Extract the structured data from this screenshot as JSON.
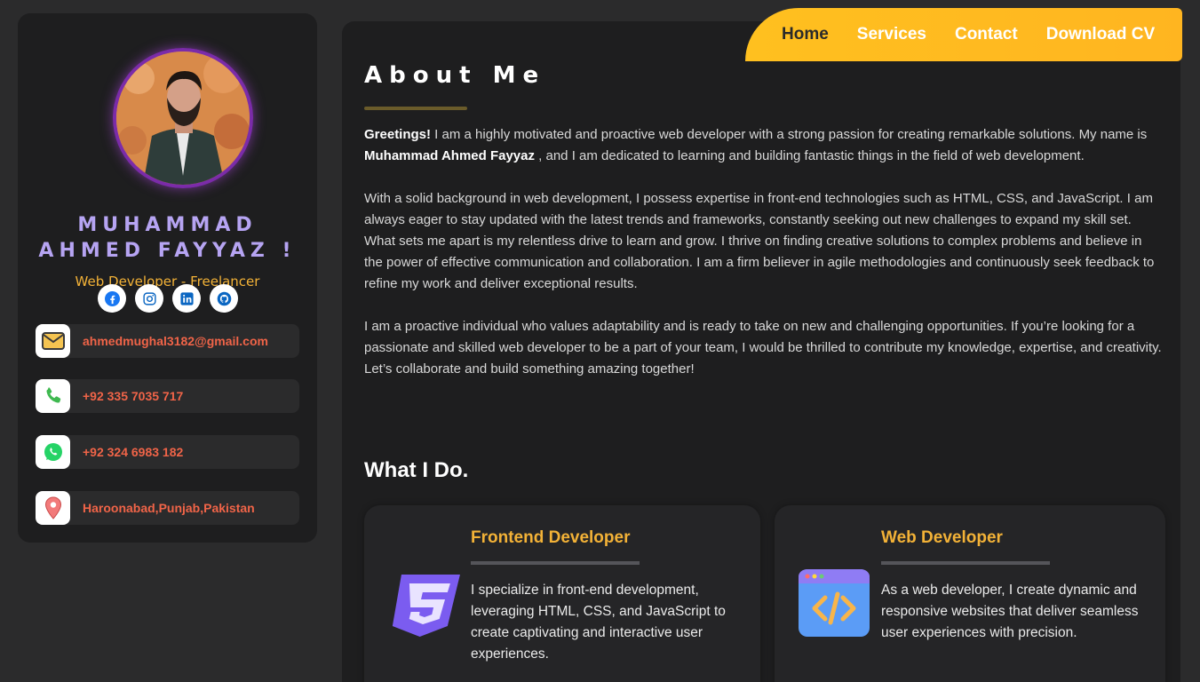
{
  "profile": {
    "name_line1": "MUHAMMAD",
    "name_line2": "AHMED FAYYAZ !",
    "role": "Web Developer - Freelancer"
  },
  "socials": [
    {
      "icon": "facebook-icon"
    },
    {
      "icon": "instagram-icon"
    },
    {
      "icon": "linkedin-icon"
    },
    {
      "icon": "github-icon"
    }
  ],
  "contacts": {
    "email": "ahmedmughal3182@gmail.com",
    "phone": "+92 335 7035 717",
    "whatsapp": "+92 324 6983 182",
    "location": "Haroonabad,Punjab,Pakistan"
  },
  "nav": {
    "home": "Home",
    "services": "Services",
    "contact": "Contact",
    "download": "Download CV"
  },
  "about": {
    "title": "About Me",
    "p1_greeting": "Greetings!",
    "p1_a": " I am a highly motivated and proactive web developer with a strong passion for creating remarkable solutions. My name is ",
    "p1_name": "Muhammad Ahmed Fayyaz",
    "p1_b": " , and I am dedicated to learning and building fantastic things in the field of web development.",
    "p2": "With a solid background in web development, I possess expertise in front-end technologies such as HTML, CSS, and JavaScript. I am always eager to stay updated with the latest trends and frameworks, constantly seeking out new challenges to expand my skill set. What sets me apart is my relentless drive to learn and grow. I thrive on finding creative solutions to complex problems and believe in the power of effective communication and collaboration. I am a firm believer in agile methodologies and continuously seek feedback to refine my work and deliver exceptional results.",
    "p3": "I am a proactive individual who values adaptability and is ready to take on new and challenging opportunities. If you’re looking for a passionate and skilled web developer to be a part of your team, I would be thrilled to contribute my knowledge, expertise, and creativity. Let’s collaborate and build something amazing together!"
  },
  "whatido": {
    "title": "What I Do.",
    "services": [
      {
        "title": "Frontend Developer",
        "desc": "I specialize in front-end development, leveraging HTML, CSS, and JavaScript to create captivating and interactive user experiences.",
        "icon": "css3-icon"
      },
      {
        "title": "Web Developer",
        "desc": "As a web developer, I create dynamic and responsive websites that deliver seamless user experiences with precision.",
        "icon": "code-window-icon"
      }
    ]
  },
  "colors": {
    "accent": "#f3b237",
    "name": "#b6a4f2",
    "contact_text": "#f06448",
    "nav_bg": "#ffc01f"
  }
}
